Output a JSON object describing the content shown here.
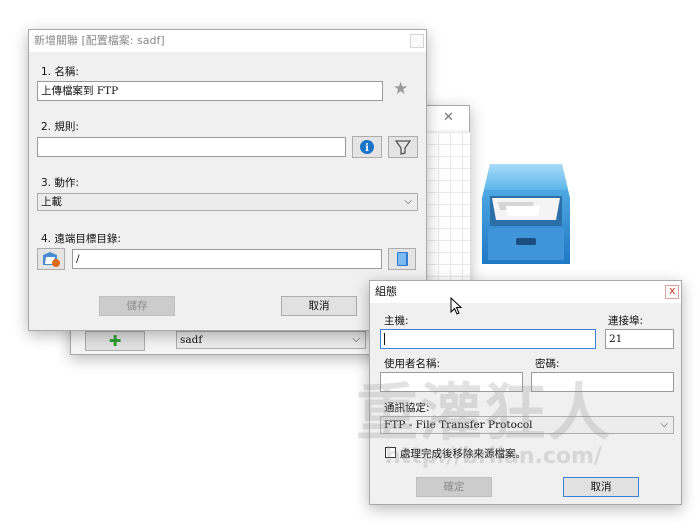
{
  "rule_dialog": {
    "title": "新增關聯 [配置檔案: sadf]",
    "name_label": "1. 名稱:",
    "name_value": "上傳檔案到 FTP",
    "rule_label": "2. 規則:",
    "rule_value": "",
    "action_label": "3. 動作:",
    "action_value": "上載",
    "target_label": "4. 遠端目標目錄:",
    "target_value": "/",
    "save_label": "儲存",
    "cancel_label": "取消"
  },
  "background_window": {
    "profile_value": "sadf",
    "close_glyph": "✕"
  },
  "config_dialog": {
    "title": "組態",
    "close_glyph": "x",
    "host_label": "主機:",
    "host_value": "",
    "port_label": "連接埠:",
    "port_value": "21",
    "username_label": "使用者名稱:",
    "username_value": "",
    "password_label": "密碼:",
    "password_value": "",
    "protocol_label": "通訊協定:",
    "protocol_value": "FTP - File Transfer Protocol",
    "delete_source_label": "處理完成後移除來源檔案。",
    "ok_label": "確定",
    "cancel_label": "取消"
  },
  "watermark": {
    "text": "重灌狂人",
    "url": "http://briian.com/"
  }
}
